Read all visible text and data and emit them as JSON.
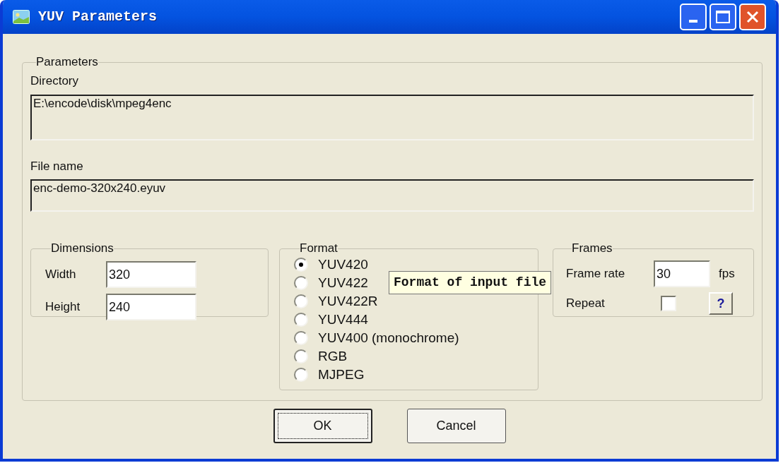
{
  "window": {
    "title": "YUV Parameters"
  },
  "parameters": {
    "legend": "Parameters",
    "directory": {
      "label": "Directory",
      "value": "E:\\encode\\disk\\mpeg4enc"
    },
    "file_name": {
      "label": "File name",
      "value": "enc-demo-320x240.eyuv"
    }
  },
  "dimensions": {
    "legend": "Dimensions",
    "fields": [
      {
        "label": "Width",
        "value": "320"
      },
      {
        "label": "Height",
        "value": "240"
      }
    ]
  },
  "format": {
    "legend": "Format",
    "tooltip": "Format of input file",
    "options": [
      {
        "label": "YUV420",
        "selected": true
      },
      {
        "label": "YUV422",
        "selected": false
      },
      {
        "label": "YUV422R",
        "selected": false
      },
      {
        "label": "YUV444",
        "selected": false
      },
      {
        "label": "YUV400 (monochrome)",
        "selected": false
      },
      {
        "label": "RGB",
        "selected": false
      },
      {
        "label": "MJPEG",
        "selected": false
      }
    ]
  },
  "frames": {
    "legend": "Frames",
    "frame_rate": {
      "label": "Frame rate",
      "value": "30",
      "unit": "fps"
    },
    "repeat": {
      "label": "Repeat",
      "checked": false
    },
    "help_button": "?"
  },
  "buttons": [
    {
      "label": "OK",
      "focused": true
    },
    {
      "label": "Cancel",
      "focused": false
    }
  ]
}
